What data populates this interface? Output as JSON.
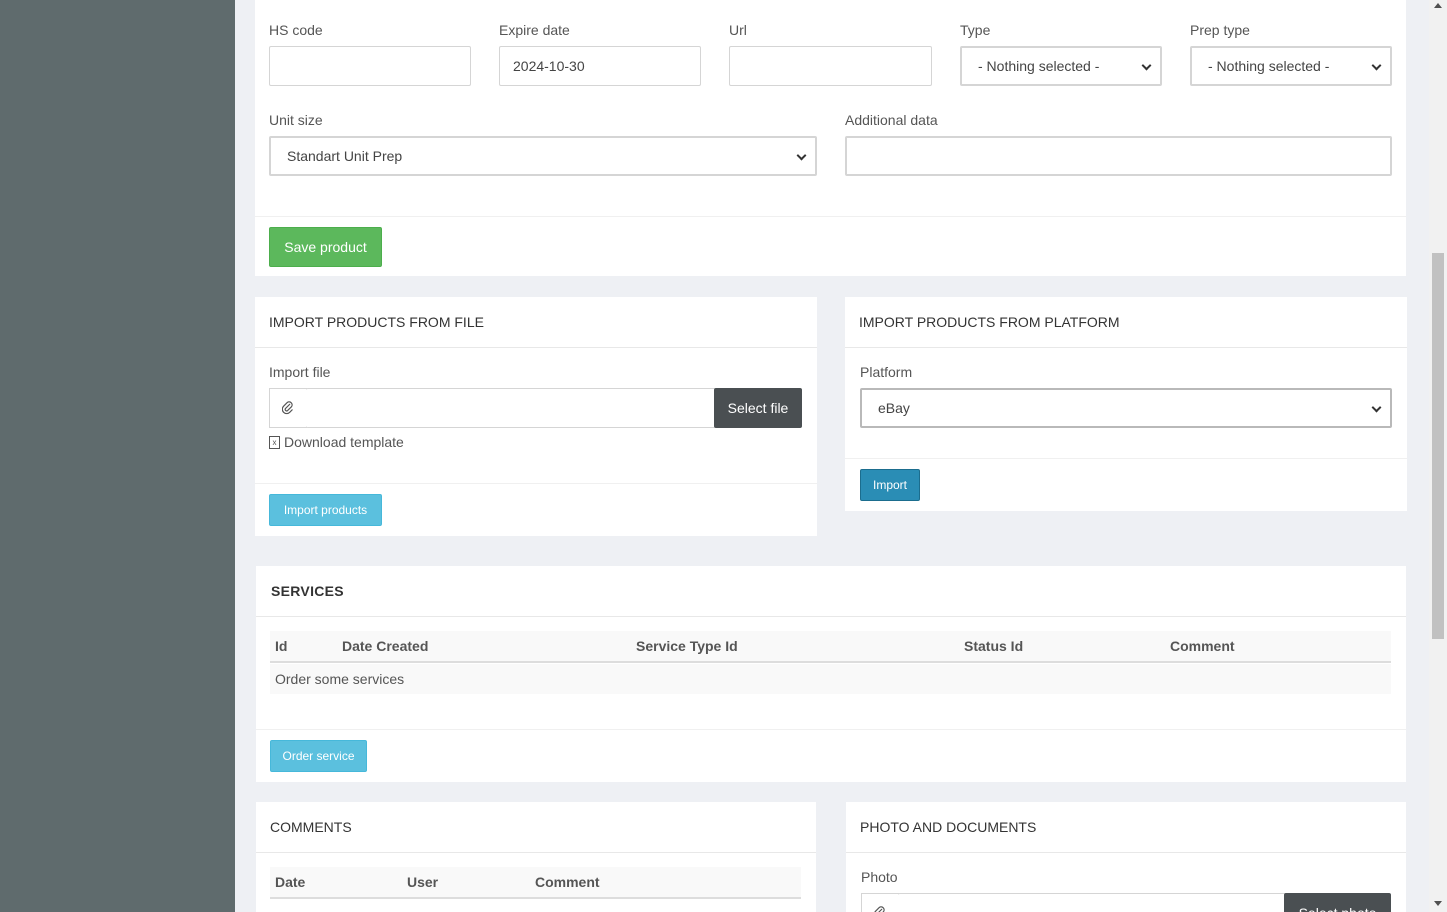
{
  "product_form": {
    "hs_code_label": "HS code",
    "hs_code_value": "",
    "expire_date_label": "Expire date",
    "expire_date_value": "2024-10-30",
    "url_label": "Url",
    "url_value": "",
    "type_label": "Type",
    "type_value": "- Nothing selected -",
    "prep_type_label": "Prep type",
    "prep_type_value": "- Nothing selected -",
    "unit_size_label": "Unit size",
    "unit_size_value": "Standart Unit Prep",
    "additional_data_label": "Additional data",
    "additional_data_value": "",
    "save_label": "Save product"
  },
  "import_file": {
    "title": "IMPORT PRODUCTS FROM FILE",
    "file_label": "Import file",
    "select_label": "Select file",
    "template_label": "Download template",
    "import_label": "Import products"
  },
  "import_platform": {
    "title": "IMPORT PRODUCTS FROM PLATFORM",
    "platform_label": "Platform",
    "platform_value": "eBay",
    "import_label": "Import"
  },
  "services": {
    "title": "SERVICES",
    "columns": [
      "Id",
      "Date Created",
      "Service Type Id",
      "Status Id",
      "Comment"
    ],
    "empty_text": "Order some services",
    "order_label": "Order service"
  },
  "comments": {
    "title": "COMMENTS",
    "columns": [
      "Date",
      "User",
      "Comment"
    ]
  },
  "photos": {
    "title": "PHOTO AND DOCUMENTS",
    "photo_label": "Photo",
    "select_label": "Select photo"
  }
}
